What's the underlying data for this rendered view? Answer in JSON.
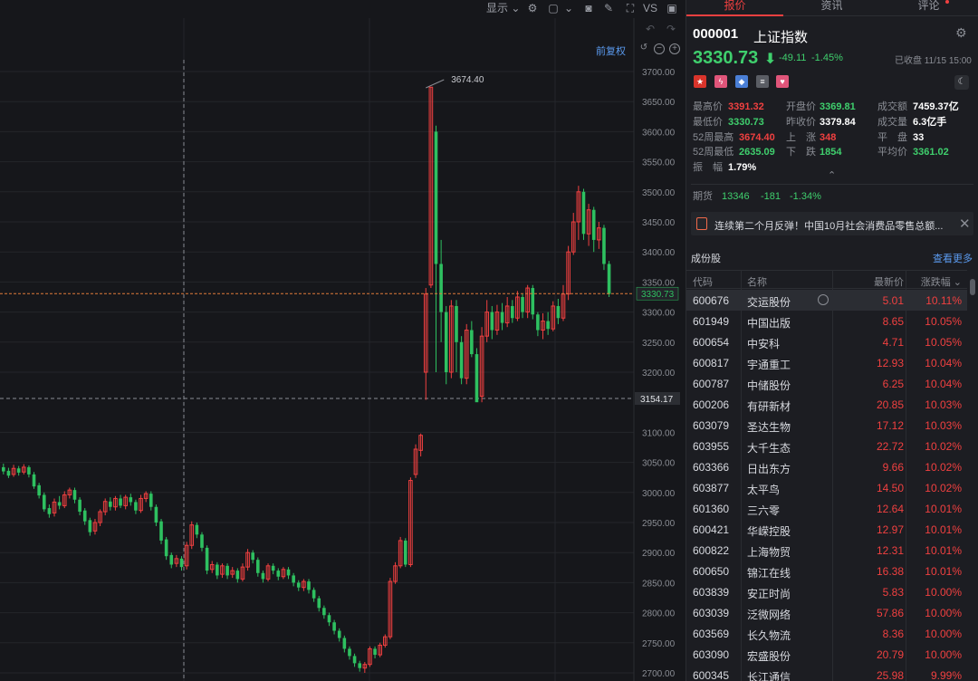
{
  "toolbar": {
    "display_label": "显示",
    "vs_label": "VS",
    "adjust_label": "前复权"
  },
  "chart": {
    "high_marker": "3674.40",
    "current_price_tag": "3330.73",
    "crosshair_price_tag": "3154.17",
    "y_ticks": [
      "3700.00",
      "3650.00",
      "3600.00",
      "3550.00",
      "3500.00",
      "3450.00",
      "3400.00",
      "3350.00",
      "3300.00",
      "3250.00",
      "3200.00",
      "3100.00",
      "3050.00",
      "3000.00",
      "2950.00",
      "2900.00",
      "2850.00",
      "2800.00",
      "2750.00",
      "2700.00"
    ],
    "colors": {
      "up": "#f04040",
      "down": "#2ec060",
      "background": "#16171b",
      "grid": "#24262b",
      "crosshair": "#8a8d94",
      "price_line": "#e07a3a"
    }
  },
  "tabs": [
    {
      "label": "报价",
      "active": true
    },
    {
      "label": "资讯",
      "active": false
    },
    {
      "label": "评论",
      "active": false
    }
  ],
  "quote": {
    "code": "000001",
    "name": "上证指数",
    "price": "3330.73",
    "change": "-49.11",
    "change_pct": "-1.45%",
    "status": "已收盘 11/15 15:00"
  },
  "badges": [
    {
      "icon": "china-flag-icon",
      "color": "#d9342b",
      "glyph": "★"
    },
    {
      "icon": "lightning-icon",
      "color": "#e0557a",
      "glyph": "ϟ"
    },
    {
      "icon": "tag-icon",
      "color": "#4a7fd6",
      "glyph": "◆"
    },
    {
      "icon": "list-icon",
      "color": "#5a5d64",
      "glyph": "≡"
    },
    {
      "icon": "heart-icon",
      "color": "#e0557a",
      "glyph": "♥"
    }
  ],
  "stats": {
    "high": {
      "label": "最高价",
      "value": "3391.32"
    },
    "low": {
      "label": "最低价",
      "value": "3330.73"
    },
    "high52": {
      "label": "52周最高",
      "value": "3674.40"
    },
    "low52": {
      "label": "52周最低",
      "value": "2635.09"
    },
    "amplitude": {
      "label": "振　幅",
      "value": "1.79%"
    },
    "open": {
      "label": "开盘价",
      "value": "3369.81"
    },
    "prev_close": {
      "label": "昨收价",
      "value": "3379.84"
    },
    "up": {
      "label": "上　涨",
      "value": "348"
    },
    "down": {
      "label": "下　跌",
      "value": "1854"
    },
    "turnover": {
      "label": "成交额",
      "value": "7459.37亿"
    },
    "volume": {
      "label": "成交量",
      "value": "6.3亿手"
    },
    "flat": {
      "label": "平　盘",
      "value": "33"
    },
    "avg": {
      "label": "平均价",
      "value": "3361.02"
    }
  },
  "futures": {
    "label": "期货",
    "price": "13346",
    "change": "-181",
    "change_pct": "-1.34%"
  },
  "news": {
    "text": "连续第二个月反弹！中国10月社会消费品零售总额..."
  },
  "constituents": {
    "title": "成份股",
    "more": "查看更多",
    "headers": {
      "code": "代码",
      "name": "名称",
      "price": "最新价",
      "pct": "涨跌幅 ⌄"
    },
    "rows": [
      {
        "code": "600676",
        "name": "交运股份",
        "price": "5.01",
        "pct": "10.11%"
      },
      {
        "code": "601949",
        "name": "中国出版",
        "price": "8.65",
        "pct": "10.05%"
      },
      {
        "code": "600654",
        "name": "中安科",
        "price": "4.71",
        "pct": "10.05%"
      },
      {
        "code": "600817",
        "name": "宇通重工",
        "price": "12.93",
        "pct": "10.04%"
      },
      {
        "code": "600787",
        "name": "中储股份",
        "price": "6.25",
        "pct": "10.04%"
      },
      {
        "code": "600206",
        "name": "有研新材",
        "price": "20.85",
        "pct": "10.03%"
      },
      {
        "code": "603079",
        "name": "圣达生物",
        "price": "17.12",
        "pct": "10.03%"
      },
      {
        "code": "603955",
        "name": "大千生态",
        "price": "22.72",
        "pct": "10.02%"
      },
      {
        "code": "603366",
        "name": "日出东方",
        "price": "9.66",
        "pct": "10.02%"
      },
      {
        "code": "603877",
        "name": "太平鸟",
        "price": "14.50",
        "pct": "10.02%"
      },
      {
        "code": "601360",
        "name": "三六零",
        "price": "12.64",
        "pct": "10.01%"
      },
      {
        "code": "600421",
        "name": "华嵘控股",
        "price": "12.97",
        "pct": "10.01%"
      },
      {
        "code": "600822",
        "name": "上海物贸",
        "price": "12.31",
        "pct": "10.01%"
      },
      {
        "code": "600650",
        "name": "锦江在线",
        "price": "16.38",
        "pct": "10.01%"
      },
      {
        "code": "603839",
        "name": "安正时尚",
        "price": "5.83",
        "pct": "10.00%"
      },
      {
        "code": "603039",
        "name": "泛微网络",
        "price": "57.86",
        "pct": "10.00%"
      },
      {
        "code": "603569",
        "name": "长久物流",
        "price": "8.36",
        "pct": "10.00%"
      },
      {
        "code": "603090",
        "name": "宏盛股份",
        "price": "20.79",
        "pct": "10.00%"
      },
      {
        "code": "600345",
        "name": "长江通信",
        "price": "25.98",
        "pct": "9.99%"
      }
    ]
  }
}
